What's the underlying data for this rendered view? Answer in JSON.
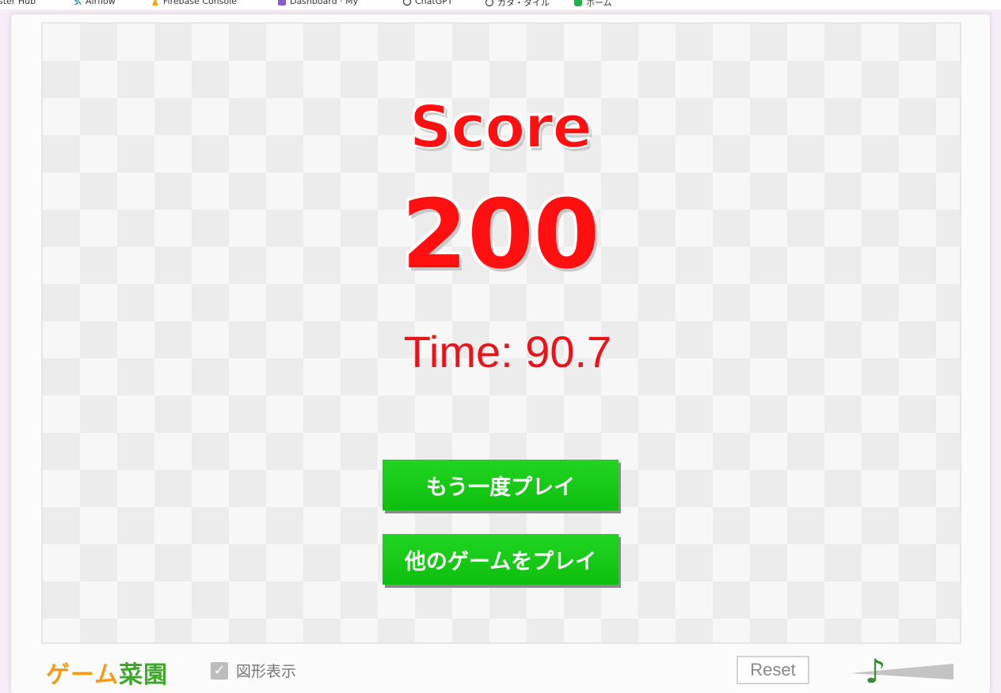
{
  "bookmarks": [
    {
      "label": "ster Hub",
      "icon": "page-icon"
    },
    {
      "label": "Airflow",
      "icon": "airflow-icon"
    },
    {
      "label": "Firebase Console",
      "icon": "firebase-icon"
    },
    {
      "label": "Dashboard · My",
      "icon": "dashboard-icon"
    },
    {
      "label": "ChatGPT",
      "icon": "chatgpt-icon"
    },
    {
      "label": "カタ・タイル",
      "icon": "app-icon"
    },
    {
      "label": "ホーム",
      "icon": "home-icon"
    }
  ],
  "result": {
    "score_label": "Score",
    "score_value": "200",
    "time_text": "Time: 90.7"
  },
  "buttons": {
    "play_again": "もう一度プレイ",
    "other_games": "他のゲームをプレイ"
  },
  "footer": {
    "logo_part1": "ゲーム",
    "logo_part2": "菜園",
    "checkbox_label": "図形表示",
    "checkbox_checked": true,
    "reset_label": "Reset",
    "music_icon": "music-note-icon"
  },
  "colors": {
    "score": "#ff1010",
    "button": "#11c611",
    "logo_orange": "#f59a14",
    "logo_green": "#3fa82a"
  }
}
